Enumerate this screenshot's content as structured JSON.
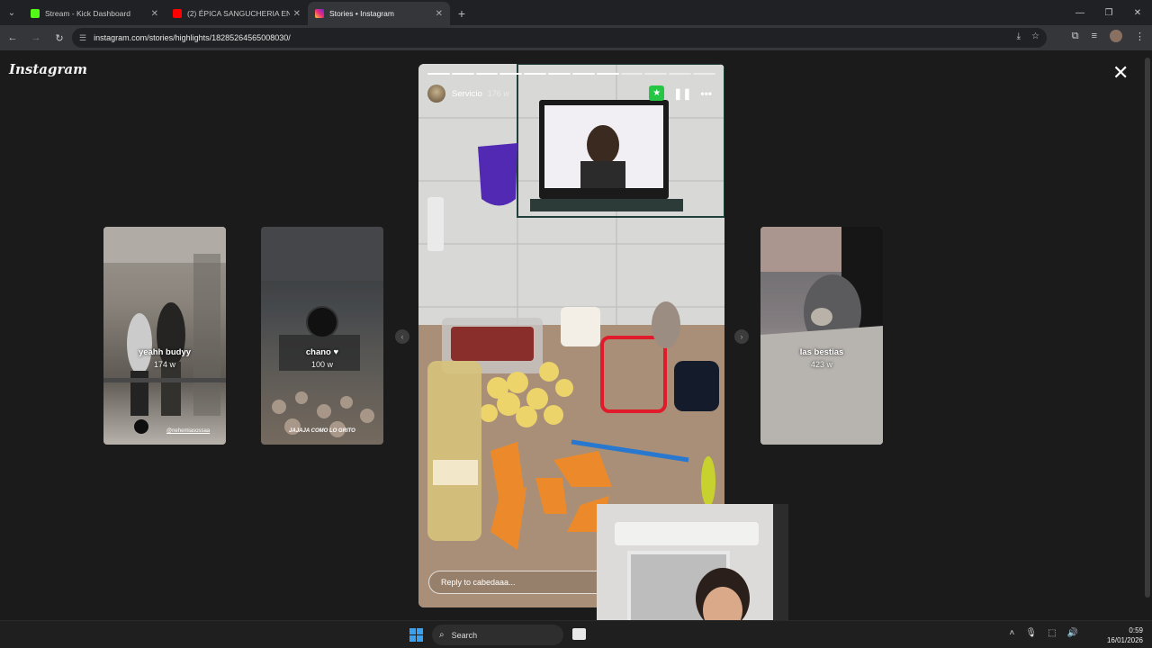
{
  "browser": {
    "tabs": [
      {
        "label": "Stream - Kick Dashboard",
        "favicon_color": "#53fc18",
        "active": false
      },
      {
        "label": "(2) ÉPICA SANGUCHERIA EN EL",
        "favicon_color": "#ff0000",
        "active": false
      },
      {
        "label": "Stories • Instagram",
        "favicon_color": "#e1306c",
        "active": true
      }
    ],
    "url": "instagram.com/stories/highlights/18285264565008030/"
  },
  "page": {
    "logo": "Instagram",
    "main_story": {
      "username": "Servicio",
      "age": "176 w",
      "reply_placeholder": "Reply to cabedaaa...",
      "segments_total": 12,
      "segments_done": 8,
      "more_icon": "more-horizontal-icon",
      "pause_icon": "pause-icon",
      "badge_icon": "star-icon",
      "badge_color": "#25c645"
    },
    "side_stories": [
      {
        "name": "yeahh budyy",
        "age": "174 w",
        "handle": "@nehemiasossaa"
      },
      {
        "name": "chano ♥",
        "age": "100 w",
        "caption": "JAJAJA COMO LO GRITO"
      },
      {
        "name": "las bestias",
        "age": "423 w"
      }
    ]
  },
  "taskbar": {
    "search_label": "Search",
    "time": "0:59",
    "date": "16/01/2026"
  }
}
